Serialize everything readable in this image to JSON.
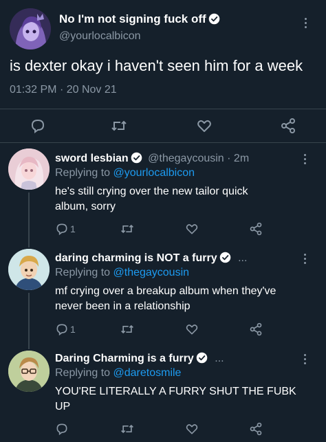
{
  "main_tweet": {
    "display_name": "No I'm not signing fuck off",
    "handle": "@yourlocalbicon",
    "text": "is dexter okay i haven't seen him for a week",
    "time": "01:32 PM",
    "dot": "·",
    "date": "20 Nov 21"
  },
  "replies": [
    {
      "display_name": "sword lesbian",
      "handle": "@thegaycousin",
      "dot": "·",
      "time": "2m",
      "replying_prefix": "Replying to",
      "replying_to": "@yourlocalbicon",
      "text_line1": "he's still crying over the new tailor quick",
      "text_line2": "album, sorry",
      "reply_count": "1"
    },
    {
      "display_name": "daring charming is NOT a furry",
      "ellipsis": "...",
      "replying_prefix": "Replying to",
      "replying_to": "@thegaycousin",
      "text_line1": "mf crying over a breakup album when they've",
      "text_line2": "never been in a relationship",
      "reply_count": "1"
    },
    {
      "display_name": "Daring Charming is a furry",
      "ellipsis": "...",
      "replying_prefix": "Replying to",
      "replying_to": "@daretosmile",
      "text_line1": "YOU'RE LITERALLY A FURRY SHUT THE FUBK",
      "text_line2": "UP"
    }
  ],
  "colors": {
    "background": "#15202b",
    "accent": "#1d9bf0",
    "muted": "#8b98a5",
    "divider": "#38444d"
  }
}
